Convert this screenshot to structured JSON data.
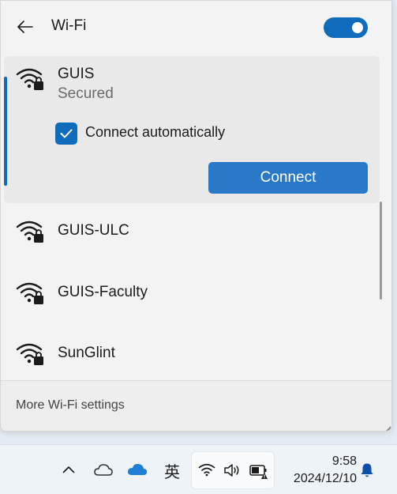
{
  "flyout": {
    "title": "Wi-Fi",
    "wifi_enabled": true
  },
  "networks": [
    {
      "name": "GUIS",
      "status": "Secured",
      "secured": true,
      "expanded": true
    },
    {
      "name": "GUIS-ULC",
      "secured": true
    },
    {
      "name": "GUIS-Faculty",
      "secured": true
    },
    {
      "name": "SunGlint",
      "secured": true
    }
  ],
  "expanded_network": {
    "auto_connect_label": "Connect automatically",
    "auto_connect_checked": true,
    "connect_label": "Connect"
  },
  "footer": {
    "more_settings_label": "More Wi-Fi settings"
  },
  "taskbar": {
    "ime_label": "英",
    "time": "9:58",
    "date": "2024/12/10"
  },
  "colors": {
    "accent": "#0f6cbd",
    "connect_button": "#2a79c9",
    "flyout_bg": "#f3f3f3",
    "taskbar_bg": "#eef3f8"
  }
}
